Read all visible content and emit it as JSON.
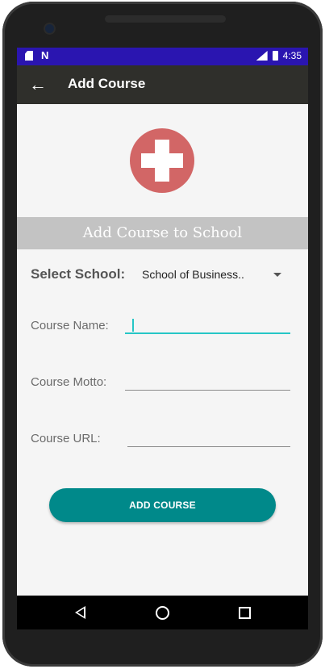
{
  "status_bar": {
    "time": "4:35",
    "icons": [
      "sd-card-icon",
      "n-notification-icon",
      "lte-signal-icon",
      "battery-icon"
    ]
  },
  "app_bar": {
    "title": "Add Course",
    "back_icon": "arrow-left-icon"
  },
  "hero": {
    "icon": "plus-circle-icon",
    "color": "#d26666"
  },
  "section_header": "Add Course to School",
  "form": {
    "select_label": "Select School:",
    "select_value": "School of Business..",
    "course_name_label": "Course Name:",
    "course_name_value": "",
    "course_motto_label": "Course Motto:",
    "course_motto_value": "",
    "course_url_label": "Course URL:",
    "course_url_value": ""
  },
  "button": {
    "label": "ADD COURSE",
    "color": "#00898a"
  },
  "colors": {
    "status_bar": "#2a15b0",
    "app_bar": "#2f2f2b",
    "accent": "#26c6c6"
  }
}
